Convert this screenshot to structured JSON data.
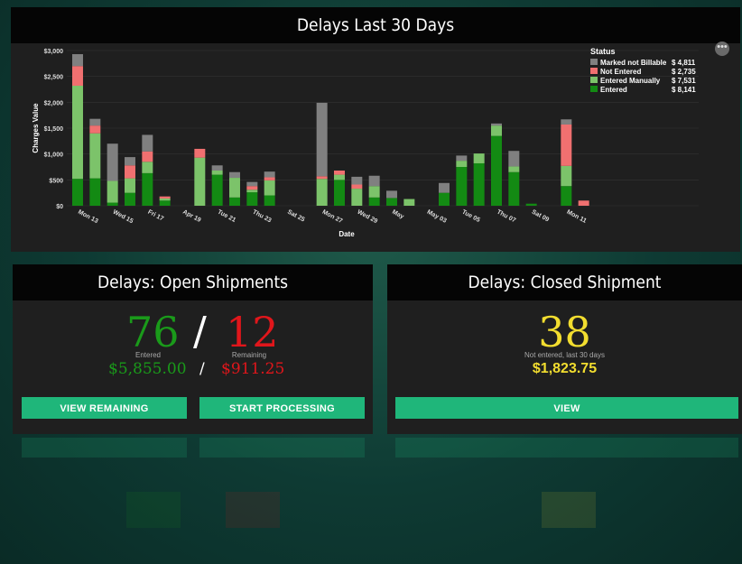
{
  "chart_panel": {
    "title": "Delays Last 30 Days",
    "more_icon": "ellipsis-icon"
  },
  "chart_data": {
    "type": "bar",
    "stacked": true,
    "xlabel": "Date",
    "ylabel": "Charges Value",
    "y_ticks": [
      "$0",
      "$500",
      "$1,000",
      "$1,500",
      "$2,000",
      "$2,500",
      "$3,000"
    ],
    "ylim": [
      0,
      3000
    ],
    "x_tick_labels": [
      "Mon 13",
      "Wed 15",
      "Fri 17",
      "Apr 19",
      "Tue 21",
      "Thu 23",
      "Sat 25",
      "Mon 27",
      "Wed 29",
      "May",
      "May 03",
      "Tue 05",
      "Thu 07",
      "Sat 09",
      "Mon 11"
    ],
    "legend": {
      "title": "Status",
      "placement": "top-right",
      "entries": [
        {
          "name": "Marked not Billable",
          "value": "$ 4,811",
          "color": "#808080"
        },
        {
          "name": "Not Entered",
          "value": "$ 2,735",
          "color": "#f07070"
        },
        {
          "name": "Entered Manually",
          "value": "$ 7,531",
          "color": "#7cc36a"
        },
        {
          "name": "Entered",
          "value": "$ 8,141",
          "color": "#138a13"
        }
      ]
    },
    "series": [
      {
        "name": "Entered",
        "color": "#138a13",
        "values": [
          520,
          530,
          60,
          250,
          630,
          100,
          0,
          0,
          0,
          0,
          0,
          0,
          0,
          0,
          0,
          300,
          0,
          0,
          0,
          0,
          0,
          0,
          0,
          0,
          0,
          0,
          0,
          0,
          0,
          0,
          0,
          0,
          0,
          0,
          0,
          0,
          0,
          0,
          0,
          0,
          0,
          0,
          0,
          0,
          0,
          0,
          0
        ]
      },
      {
        "name": "Entered Manually",
        "color": "#7cc36a",
        "values": [
          1800,
          870,
          420,
          280,
          220,
          40,
          0,
          0,
          0,
          0,
          0,
          0,
          0,
          0,
          0,
          0,
          0,
          0,
          0,
          0,
          0,
          0,
          0,
          0,
          0,
          0,
          0,
          0,
          0,
          0,
          0,
          0,
          0,
          0,
          0,
          0,
          0,
          0,
          0,
          0,
          0,
          0,
          0,
          0,
          0,
          0,
          0
        ]
      },
      {
        "name": "Not Entered",
        "color": "#f07070",
        "values": [
          380,
          150,
          0,
          250,
          200,
          40,
          0,
          0,
          0,
          0,
          0,
          0,
          0,
          0,
          0,
          0,
          0,
          0,
          0,
          0,
          0,
          0,
          0,
          0,
          0,
          0,
          0,
          0,
          0,
          0,
          0,
          0,
          0,
          0,
          0,
          0,
          0,
          0,
          0,
          0,
          0,
          0,
          0,
          0,
          0,
          0,
          0
        ]
      },
      {
        "name": "Marked not Billable",
        "color": "#808080",
        "values": [
          230,
          130,
          720,
          160,
          320,
          0,
          0,
          0,
          0,
          0,
          0,
          0,
          0,
          0,
          0,
          0,
          0,
          0,
          0,
          0,
          0,
          0,
          0,
          0,
          0,
          0,
          0,
          0,
          0,
          0,
          0,
          0,
          0,
          0,
          0,
          0,
          0,
          0,
          0,
          0,
          0,
          0,
          0,
          0,
          0,
          0,
          0
        ]
      }
    ],
    "bars": [
      {
        "x": "Mon 13",
        "entered": 520,
        "manual": 1800,
        "not_entered": 380,
        "not_billable": 230
      },
      {
        "x": "Tue 14",
        "entered": 530,
        "manual": 870,
        "not_entered": 150,
        "not_billable": 130
      },
      {
        "x": "Wed 15",
        "entered": 60,
        "manual": 420,
        "not_entered": 0,
        "not_billable": 720
      },
      {
        "x": "Thu 16",
        "entered": 250,
        "manual": 280,
        "not_entered": 250,
        "not_billable": 160
      },
      {
        "x": "Fri 17",
        "entered": 630,
        "manual": 220,
        "not_entered": 200,
        "not_billable": 320
      },
      {
        "x": "Sat 18",
        "entered": 100,
        "manual": 40,
        "not_entered": 40,
        "not_billable": 0
      },
      {
        "x": "Apr 19",
        "entered": 0,
        "manual": 0,
        "not_entered": 0,
        "not_billable": 0
      },
      {
        "x": "Mon 20",
        "entered": 0,
        "manual": 930,
        "not_entered": 170,
        "not_billable": 0
      },
      {
        "x": "Tue 21",
        "entered": 600,
        "manual": 80,
        "not_entered": 0,
        "not_billable": 100
      },
      {
        "x": "Wed 22",
        "entered": 160,
        "manual": 380,
        "not_entered": 0,
        "not_billable": 110
      },
      {
        "x": "Thu 23",
        "entered": 260,
        "manual": 50,
        "not_entered": 70,
        "not_billable": 80
      },
      {
        "x": "Fri 24",
        "entered": 200,
        "manual": 290,
        "not_entered": 60,
        "not_billable": 110
      },
      {
        "x": "Sat 25",
        "entered": 0,
        "manual": 0,
        "not_entered": 0,
        "not_billable": 0
      },
      {
        "x": "Sun 26",
        "entered": 0,
        "manual": 0,
        "not_entered": 0,
        "not_billable": 0
      },
      {
        "x": "Mon 27",
        "entered": 0,
        "manual": 520,
        "not_entered": 50,
        "not_billable": 1420
      },
      {
        "x": "Tue 28",
        "entered": 500,
        "manual": 100,
        "not_entered": 80,
        "not_billable": 0
      },
      {
        "x": "Wed 29",
        "entered": 0,
        "manual": 330,
        "not_entered": 80,
        "not_billable": 150
      },
      {
        "x": "Thu 30",
        "entered": 160,
        "manual": 220,
        "not_entered": 0,
        "not_billable": 200
      },
      {
        "x": "May",
        "entered": 150,
        "manual": 0,
        "not_entered": 0,
        "not_billable": 140
      },
      {
        "x": "May 02",
        "entered": 0,
        "manual": 130,
        "not_entered": 0,
        "not_billable": 0
      },
      {
        "x": "May 03",
        "entered": 0,
        "manual": 0,
        "not_entered": 0,
        "not_billable": 0
      },
      {
        "x": "May 04",
        "entered": 250,
        "manual": 0,
        "not_entered": 0,
        "not_billable": 190
      },
      {
        "x": "Tue 05",
        "entered": 750,
        "manual": 120,
        "not_entered": 0,
        "not_billable": 100
      },
      {
        "x": "Wed 06",
        "entered": 820,
        "manual": 190,
        "not_entered": 0,
        "not_billable": 0
      },
      {
        "x": "Thu 07",
        "entered": 1350,
        "manual": 200,
        "not_entered": 0,
        "not_billable": 40
      },
      {
        "x": "Fri 08",
        "entered": 650,
        "manual": 110,
        "not_entered": 0,
        "not_billable": 300
      },
      {
        "x": "Sat 09",
        "entered": 40,
        "manual": 0,
        "not_entered": 0,
        "not_billable": 0
      },
      {
        "x": "Sun 10",
        "entered": 0,
        "manual": 0,
        "not_entered": 0,
        "not_billable": 0
      },
      {
        "x": "Mon 11",
        "entered": 380,
        "manual": 390,
        "not_entered": 800,
        "not_billable": 100
      },
      {
        "x": "Tue 12",
        "entered": 0,
        "manual": 0,
        "not_entered": 100,
        "not_billable": 0
      }
    ]
  },
  "open_panel": {
    "title": "Delays: Open Shipments",
    "entered_count": "76",
    "entered_label": "Entered",
    "slash": "/",
    "remaining_count": "12",
    "remaining_label": "Remaining",
    "entered_money": "$5,855.00",
    "money_slash": "/",
    "remaining_money": "$911.25",
    "view_remaining_label": "VIEW REMAINING",
    "start_processing_label": "START PROCESSING",
    "colors": {
      "entered": "#1a9a1a",
      "remaining": "#e0161b"
    }
  },
  "closed_panel": {
    "title": "Delays: Closed Shipment",
    "count": "38",
    "sub_label": "Not entered, last 30 days",
    "money": "$1,823.75",
    "view_label": "VIEW",
    "color": "#f2dd2f"
  },
  "accent": "#1fb67a"
}
